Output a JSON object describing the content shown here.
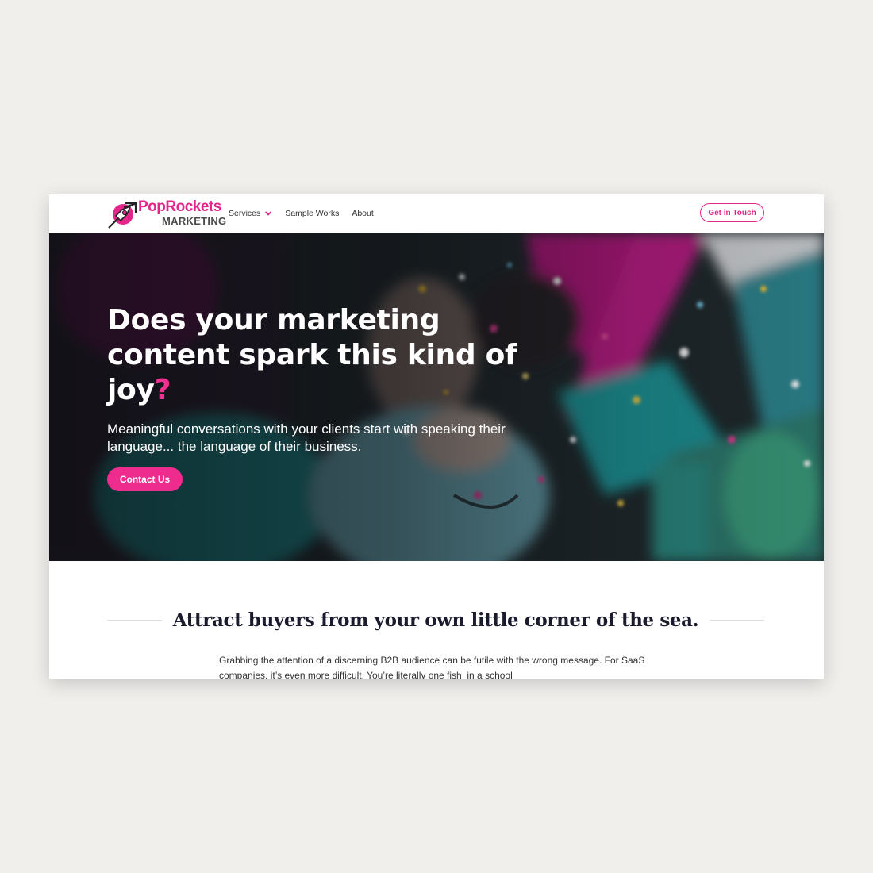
{
  "brand": {
    "name_part1": "Pop",
    "name_part2": "Rockets",
    "name_line2": "MARKETING",
    "primary_color": "#e4268a",
    "dark_text_color": "#1b1b2e"
  },
  "nav": {
    "items": [
      {
        "label": "Services",
        "has_dropdown": true
      },
      {
        "label": "Sample Works",
        "has_dropdown": false
      },
      {
        "label": "About",
        "has_dropdown": false
      }
    ],
    "cta_label": "Get in Touch"
  },
  "hero": {
    "title_main": "Does your marketing content spark this kind of joy",
    "title_accent": "?",
    "subtitle": "Meaningful conversations with your clients start with speaking their language... the language of their business.",
    "button_label": "Contact Us"
  },
  "section": {
    "heading": "Attract buyers from your own little corner of the sea.",
    "body": "Grabbing the attention of a discerning B2B audience can be futile with the wrong message. For SaaS companies, it’s even more difficult. You’re literally one fish, in a school"
  }
}
